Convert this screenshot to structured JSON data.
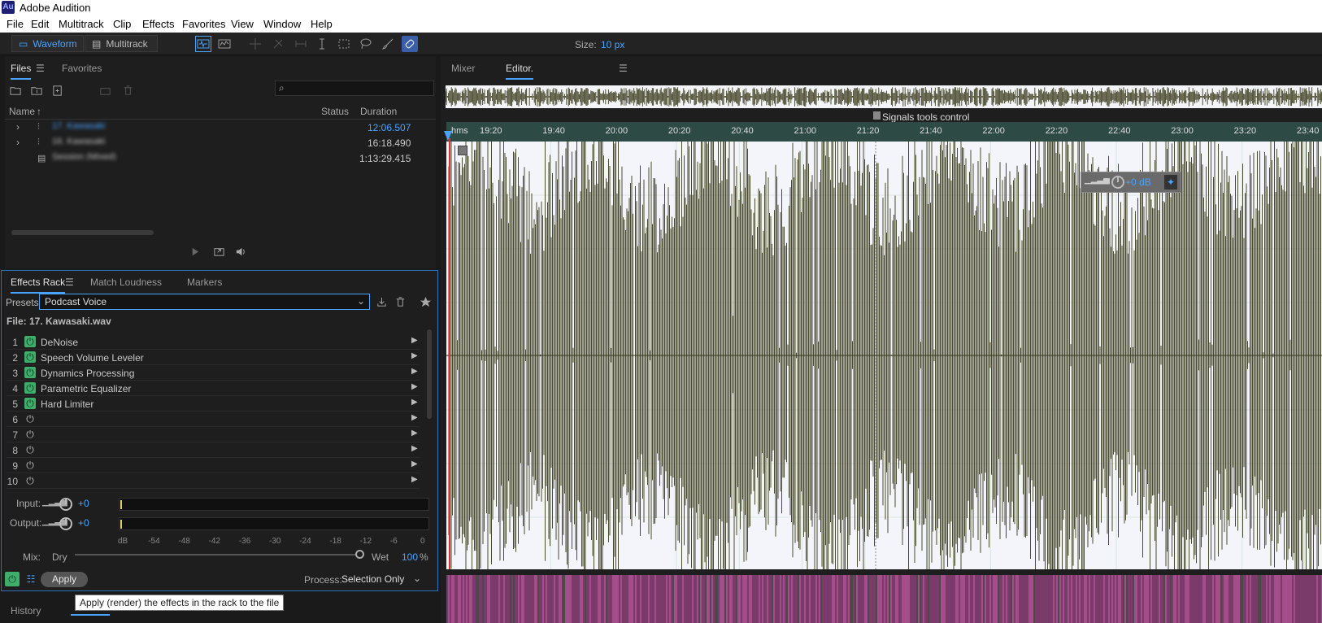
{
  "app": {
    "title": "Adobe Audition",
    "icon_text": "Au"
  },
  "menu": [
    "File",
    "Edit",
    "Multitrack",
    "Clip",
    "Effects",
    "Favorites",
    "View",
    "Window",
    "Help"
  ],
  "toolbar": {
    "waveform_label": "Waveform",
    "multitrack_label": "Multitrack",
    "size_label": "Size:",
    "size_value": "10 px"
  },
  "files_panel": {
    "tabs": [
      "Files",
      "Favorites"
    ],
    "columns": {
      "name": "Name",
      "status": "Status",
      "duration": "Duration"
    },
    "rows": [
      {
        "name": "17. Kawasaki",
        "duration": "12:06.507",
        "selected": true
      },
      {
        "name": "16. Kawasaki",
        "duration": "16:18.490",
        "selected": false
      },
      {
        "name": "Session (Mixed)",
        "duration": "1:13:29.415",
        "selected": false
      }
    ]
  },
  "effects_rack": {
    "tabs": [
      "Effects Rack",
      "Match Loudness",
      "Markers"
    ],
    "presets_label": "Presets:",
    "preset_value": "Podcast Voice",
    "file_label": "File: 17. Kawasaki.wav",
    "slots": [
      {
        "n": "1",
        "name": "DeNoise",
        "active": true
      },
      {
        "n": "2",
        "name": "Speech Volume Leveler",
        "active": true
      },
      {
        "n": "3",
        "name": "Dynamics Processing",
        "active": true
      },
      {
        "n": "4",
        "name": "Parametric Equalizer",
        "active": true
      },
      {
        "n": "5",
        "name": "Hard Limiter",
        "active": true
      },
      {
        "n": "6",
        "name": "",
        "active": false
      },
      {
        "n": "7",
        "name": "",
        "active": false
      },
      {
        "n": "8",
        "name": "",
        "active": false
      },
      {
        "n": "9",
        "name": "",
        "active": false
      },
      {
        "n": "10",
        "name": "",
        "active": false
      }
    ],
    "input_label": "Input:",
    "input_value": "+0",
    "output_label": "Output:",
    "output_value": "+0",
    "scale": [
      "dB",
      "-54",
      "-48",
      "-42",
      "-36",
      "-30",
      "-24",
      "-18",
      "-12",
      "-6",
      "0"
    ],
    "mix_label": "Mix:",
    "dry_label": "Dry",
    "wet_label": "Wet",
    "wet_value": "100",
    "wet_unit": "%",
    "apply_label": "Apply",
    "process_label": "Process:",
    "process_value": "Selection Only",
    "tooltip": "Apply (render) the effects in the rack to the file"
  },
  "bottom_tabs": {
    "history": "History"
  },
  "editor": {
    "tabs": [
      "Mixer",
      "Editor."
    ],
    "signals_label": "Signals tools control",
    "ruler_start": "hms",
    "ruler_ticks": [
      "19:20",
      "19:40",
      "20:00",
      "20:20",
      "20:40",
      "21:00",
      "21:20",
      "21:40",
      "22:00",
      "22:20",
      "22:40",
      "23:00",
      "23:20",
      "23:40"
    ],
    "hud_value": "+0 dB",
    "colors": {
      "waveform": "#4a4a2e",
      "background": "#f3f5fa",
      "ruler": "#2d4a44",
      "accent": "#4aa3ff"
    }
  }
}
